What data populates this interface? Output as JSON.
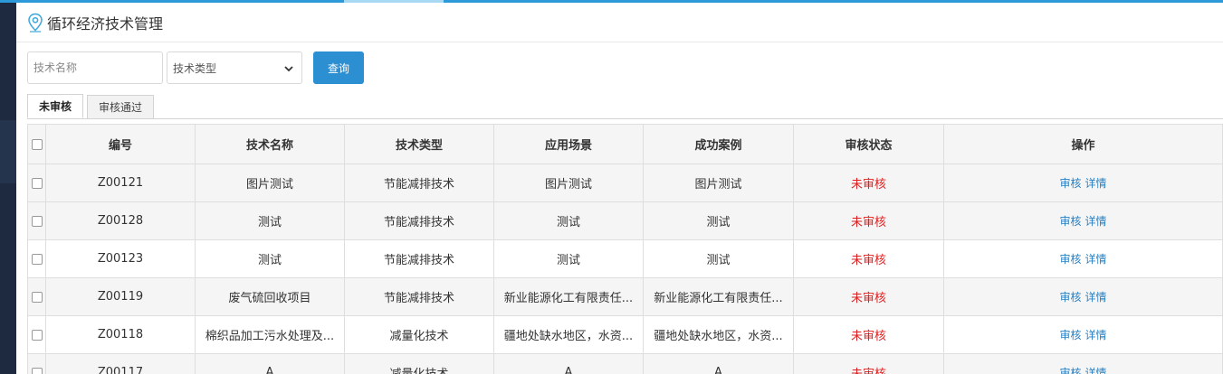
{
  "header": {
    "title": "循环经济技术管理",
    "icon": "location-pin-icon"
  },
  "filters": {
    "name_placeholder": "技术名称",
    "type_select_value": "技术类型",
    "query_label": "查询"
  },
  "tabs": [
    {
      "label": "未审核",
      "active": true
    },
    {
      "label": "审核通过",
      "active": false
    }
  ],
  "table": {
    "columns": [
      "编号",
      "技术名称",
      "技术类型",
      "应用场景",
      "成功案例",
      "审核状态",
      "操作"
    ],
    "rows": [
      {
        "id": "Z00121",
        "name": "图片测试",
        "type": "节能减排技术",
        "scene": "图片测试",
        "case": "图片测试",
        "status": "未审核",
        "op1": "审核",
        "op2": "详情"
      },
      {
        "id": "Z00128",
        "name": "测试",
        "type": "节能减排技术",
        "scene": "测试",
        "case": "测试",
        "status": "未审核",
        "op1": "审核",
        "op2": "详情"
      },
      {
        "id": "Z00123",
        "name": "测试",
        "type": "节能减排技术",
        "scene": "测试",
        "case": "测试",
        "status": "未审核",
        "op1": "审核",
        "op2": "详情"
      },
      {
        "id": "Z00119",
        "name": "废气硫回收项目",
        "type": "节能减排技术",
        "scene": "新业能源化工有限责任...",
        "case": "新业能源化工有限责任...",
        "status": "未审核",
        "op1": "审核",
        "op2": "详情"
      },
      {
        "id": "Z00118",
        "name": "棉织品加工污水处理及...",
        "type": "减量化技术",
        "scene": "疆地处缺水地区，水资...",
        "case": "疆地处缺水地区，水资...",
        "status": "未审核",
        "op1": "审核",
        "op2": "详情"
      },
      {
        "id": "Z00117",
        "name": "A",
        "type": "减量化技术",
        "scene": "A",
        "case": "A",
        "status": "未审核",
        "op1": "审核",
        "op2": "详情"
      }
    ]
  },
  "colors": {
    "accent": "#2c8fd1",
    "status_pending": "#e02020",
    "link": "#2a7fc0",
    "sidebar": "#1d2a3f"
  }
}
